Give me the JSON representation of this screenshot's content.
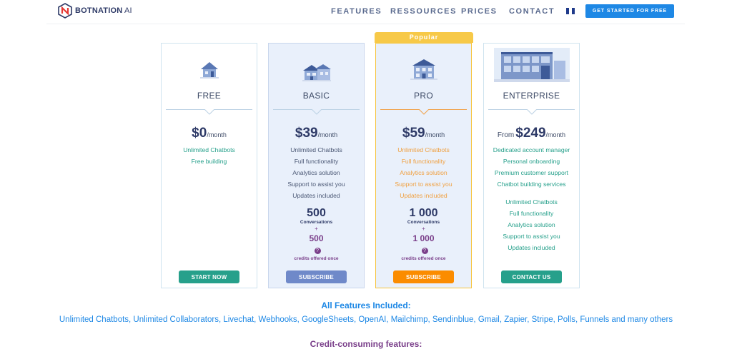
{
  "header": {
    "logo_brand": "BOTNATION",
    "logo_suffix": " AI",
    "nav": [
      "FEATURES",
      "RESSOURCES",
      "PRICES",
      "CONTACT"
    ],
    "cta_label": "GET STARTED FOR FREE",
    "flag_colors": [
      "#1f3a8a",
      "#ffffff",
      "#1f3a8a"
    ]
  },
  "plans": [
    {
      "name": "FREE",
      "price": "$0",
      "per": "/month",
      "features": [
        "Unlimited Chatbots",
        "Free building"
      ],
      "button": "START NOW"
    },
    {
      "name": "BASIC",
      "price": "$39",
      "per": "/month",
      "features": [
        "Unlimited Chatbots",
        "Full functionality",
        "Analytics solution",
        "Support to assist you",
        "Updates included"
      ],
      "conversations": "500",
      "conversations_label": "Conversations",
      "plus": "+",
      "credits": "500",
      "credits_label": "credits offered once",
      "button": "SUBSCRIBE"
    },
    {
      "badge": "Popular",
      "name": "PRO",
      "price": "$59",
      "per": "/month",
      "features": [
        "Unlimited Chatbots",
        "Full functionality",
        "Analytics solution",
        "Support to assist you",
        "Updates included"
      ],
      "conversations": "1 000",
      "conversations_label": "Conversations",
      "plus": "+",
      "credits": "1 000",
      "credits_label": "credits offered once",
      "button": "SUBSCRIBE"
    },
    {
      "name": "ENTERPRISE",
      "from": "From",
      "price": "$249",
      "per": "/month",
      "services": [
        "Dedicated account manager",
        "Personal onboarding",
        "Premium customer support",
        "Chatbot building services"
      ],
      "features": [
        "Unlimited Chatbots",
        "Full functionality",
        "Analytics solution",
        "Support to assist you",
        "Updates included"
      ],
      "button": "CONTACT US"
    }
  ],
  "bottom": {
    "all_title": "All Features Included:",
    "all_list": "Unlimited Chatbots, Unlimited Collaborators, Livechat, Webhooks, GoogleSheets, OpenAI, Mailchimp, Sendinblue, Gmail, Zapier, Stripe, Polls, Funnels and many others",
    "credit_title": "Credit-consuming features:"
  },
  "icons": {
    "question": "?"
  },
  "colors": {
    "accent_blue": "#1e88e5",
    "teal": "#26a08b",
    "orange": "#fb8c00",
    "popular_yellow": "#f7c948",
    "purple": "#7a3f8a"
  }
}
